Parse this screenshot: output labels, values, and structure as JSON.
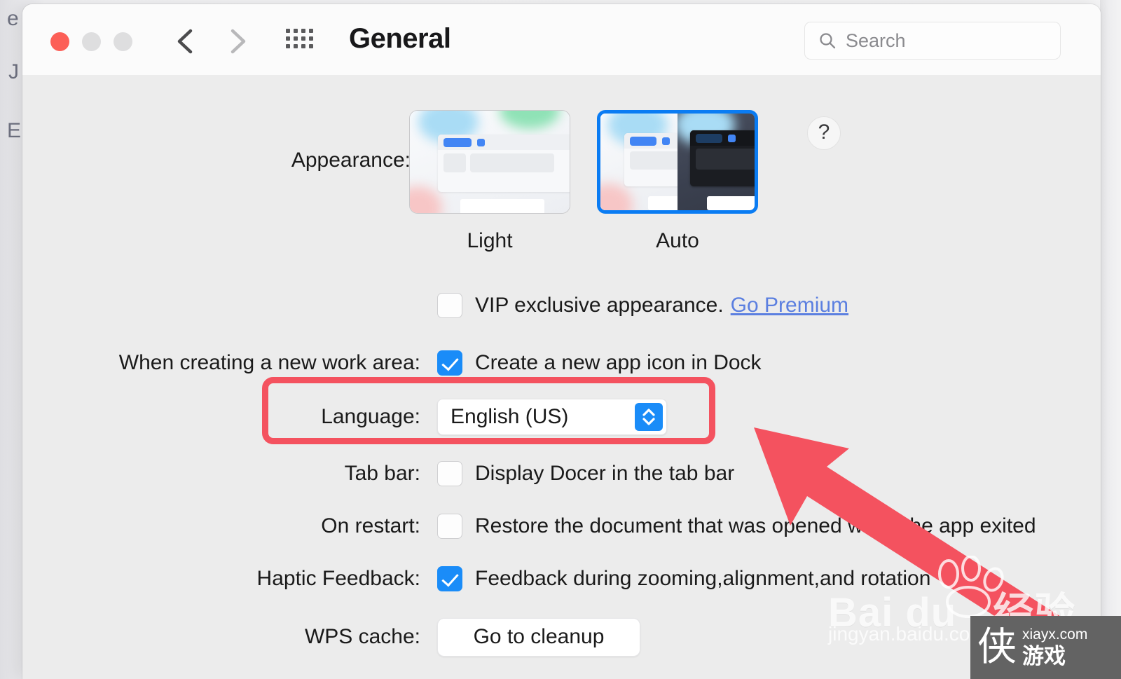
{
  "window": {
    "title": "General",
    "traffic_lights": [
      {
        "name": "close",
        "color": "#fc5f57"
      },
      {
        "name": "minimize",
        "color": "#dededf"
      },
      {
        "name": "zoom",
        "color": "#dededf"
      }
    ],
    "nav": {
      "back_icon": "chevron-left-icon",
      "forward_icon": "chevron-right-icon"
    },
    "grid_icon": "grid-apps-icon"
  },
  "search": {
    "icon": "search-icon",
    "placeholder": "Search",
    "value": ""
  },
  "appearance": {
    "label": "Appearance:",
    "options": [
      {
        "id": "light",
        "caption": "Light",
        "selected": false
      },
      {
        "id": "auto",
        "caption": "Auto",
        "selected": true
      }
    ],
    "help_label": "?",
    "selected_color": "#0a7cf3"
  },
  "rows": {
    "vip": {
      "label": "",
      "checkbox_checked": false,
      "text": "VIP exclusive appearance.",
      "link": "Go Premium",
      "link_color": "#5b7fe0"
    },
    "workarea": {
      "label": "When creating a new work area:",
      "checkbox_checked": true,
      "text": "Create a new app icon in Dock"
    },
    "language": {
      "label": "Language:",
      "value": "English (US)",
      "stepper_icon": "chevron-up-down-icon",
      "stepper_color": "#1a8cf8"
    },
    "tabbar": {
      "label": "Tab bar:",
      "checkbox_checked": false,
      "text": "Display Docer in the tab bar"
    },
    "restart": {
      "label": "On restart:",
      "checkbox_checked": false,
      "text": "Restore the document that was opened when the app exited"
    },
    "haptic": {
      "label": "Haptic Feedback:",
      "checkbox_checked": true,
      "text": "Feedback during zooming,alignment,and rotation"
    },
    "wpscache": {
      "label": "WPS cache:",
      "button_label": "Go to cleanup"
    }
  },
  "annotations": {
    "highlight_color": "#f4525f",
    "arrow_color": "#f4525f",
    "arrow_target": "language-row"
  },
  "background": {
    "letters": [
      "e",
      "J",
      "E"
    ]
  },
  "watermarks": {
    "baidu": {
      "wordmark": "Bai du",
      "suffix": "经验",
      "url": "jingyan.baidu.com"
    },
    "xiayx": {
      "glyph": "侠",
      "domain": "xiayx.com",
      "label": "游戏"
    }
  }
}
